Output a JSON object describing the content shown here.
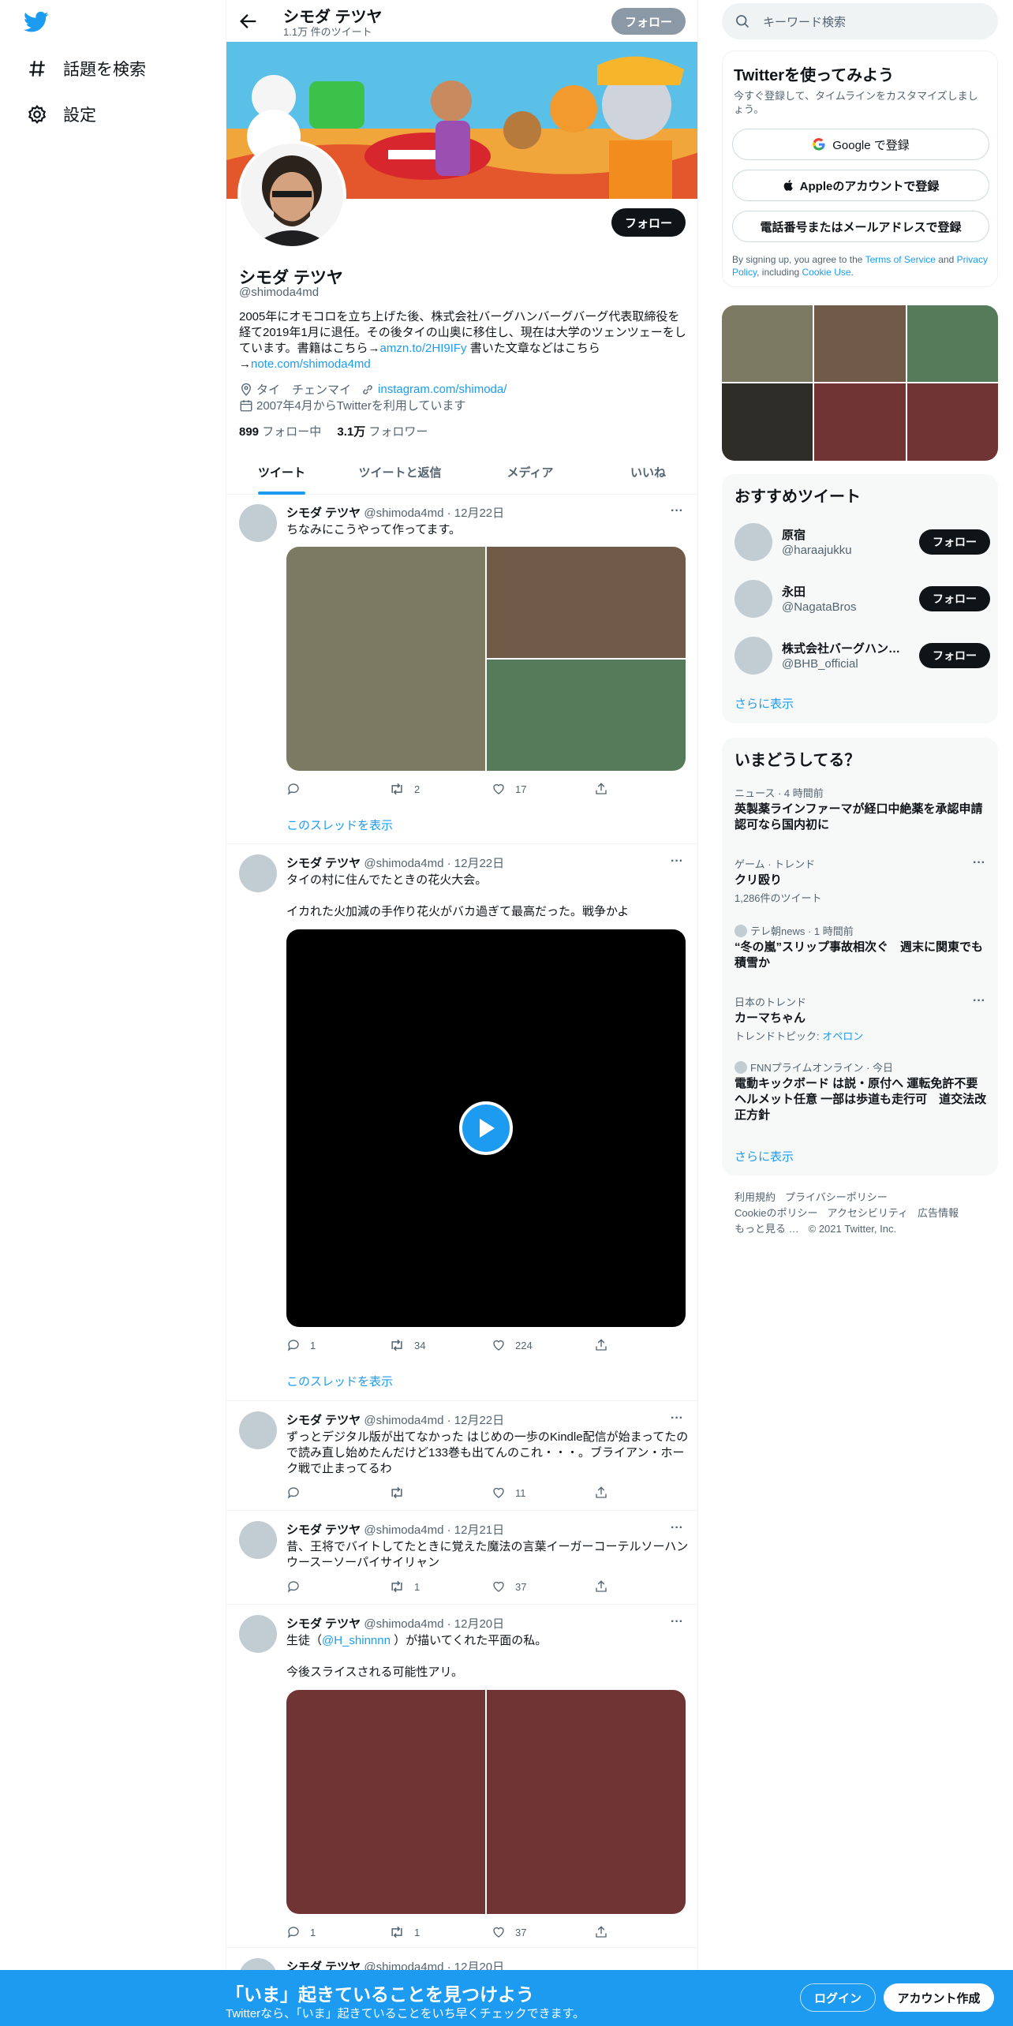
{
  "nav": {
    "explore_label": "話題を検索",
    "settings_label": "設定"
  },
  "header": {
    "name": "シモダ テツヤ",
    "tweet_count": "1.1万 件のツイート",
    "follow_label": "フォロー"
  },
  "profile": {
    "name": "シモダ テツヤ",
    "handle": "@shimoda4md",
    "follow_label": "フォロー",
    "bio_text_1": "2005年にオモコロを立ち上げた後、株式会社バーグハンバーグバーグ代表取締役を経て2019年1月に退任。その後タイの山奥に移住し、現在は大学のツェンツェーをしています。書籍はこちら→",
    "bio_link_1": "amzn.to/2HI9IFy",
    "bio_text_2": " 書いた文章などはこちら→",
    "bio_link_2": "note.com/shimoda4md",
    "location": "タイ　チェンマイ",
    "website": "instagram.com/shimoda/",
    "joined": "2007年4月からTwitterを利用しています",
    "following_count": "899",
    "following_label": " フォロー中",
    "followers_count": "3.1万",
    "followers_label": " フォロワー"
  },
  "tabs": [
    "ツイート",
    "ツイートと返信",
    "メディア",
    "いいね"
  ],
  "tweets": [
    {
      "name": "シモダ テツヤ",
      "meta": " @shimoda4md · 12月22日",
      "text": "ちなみにこうやって作ってます。",
      "reply": "",
      "retweet": "2",
      "like": "17",
      "thread": "このスレッドを表示"
    },
    {
      "name": "シモダ テツヤ",
      "meta": " @shimoda4md · 12月22日",
      "text": "タイの村に住んでたときの花火大会。\n\nイカれた火加減の手作り花火がバカ過ぎて最高だった。戦争かよ",
      "reply": "1",
      "retweet": "34",
      "like": "224",
      "thread": "このスレッドを表示"
    },
    {
      "name": "シモダ テツヤ",
      "meta": " @shimoda4md · 12月22日",
      "text": "ずっとデジタル版が出てなかった はじめの一歩のKindle配信が始まってたので読み直し始めたんだけど133巻も出てんのこれ・・・。ブライアン・ホーク戦で止まってるわ",
      "reply": "",
      "retweet": "",
      "like": "11"
    },
    {
      "name": "シモダ テツヤ",
      "meta": " @shimoda4md · 12月21日",
      "text": "昔、王将でバイトしてたときに覚えた魔法の言葉イーガーコーテルソーハンウースーソーパイサイリャン",
      "reply": "",
      "retweet": "1",
      "like": "37"
    },
    {
      "name": "シモダ テツヤ",
      "meta": " @shimoda4md · 12月20日",
      "text_a": "生徒（",
      "mention": "@H_shinnnn",
      "text_b": " ）が描いてくれた平面の私。",
      "text_c": "今後スライスされる可能性アリ。",
      "reply": "1",
      "retweet": "1",
      "like": "37"
    },
    {
      "name": "シモダ テツヤ",
      "meta": " @shimoda4md · 12月20日"
    }
  ],
  "right": {
    "search_placeholder": "キーワード検索",
    "signup": {
      "title": "Twitterを使ってみよう",
      "desc": "今すぐ登録して、タイムラインをカスタマイズしましょう。",
      "google": "Google で登録",
      "apple": "Appleのアカウントで登録",
      "phone": "電話番号またはメールアドレスで登録",
      "legal_a": "By signing up, you agree to the ",
      "tos": "Terms of Service",
      "legal_b": " and ",
      "privacy": "Privacy Policy",
      "legal_c": ", including ",
      "cookie": "Cookie Use",
      "legal_d": "."
    },
    "recommend": {
      "title": "おすすめツイート",
      "users": [
        {
          "name": "原宿",
          "handle": "@haraajukku",
          "btn": "フォロー"
        },
        {
          "name": "永田",
          "handle": "@NagataBros",
          "btn": "フォロー"
        },
        {
          "name": "株式会社バーグハン…",
          "handle": "@BHB_official",
          "btn": "フォロー"
        }
      ],
      "more": "さらに表示"
    },
    "trends": {
      "title": "いまどうしてる？",
      "items": [
        {
          "ctx": "ニュース · 4 時間前",
          "title": "英製薬ラインファーマが経口中絶薬を承認申請 認可なら国内初に",
          "sub": ""
        },
        {
          "ctx": "ゲーム · トレンド",
          "title": "クリ殴り",
          "sub": "1,286件のツイート"
        },
        {
          "ctx": "テレ朝news · 1 時間前",
          "title": "“冬の嵐”スリップ事故相次ぐ　週末に関東でも積雪か",
          "sub": ""
        },
        {
          "ctx": "日本のトレンド",
          "title": "カーマちゃん",
          "sub": "トレンドトピック: ",
          "sub_link": "オペロン"
        },
        {
          "ctx": "FNNプライムオンライン · 今日",
          "title": "電動キックボード は説・原付へ 運転免許不要 ヘルメット任意 一部は歩道も走行可　道交法改正方針",
          "sub": ""
        }
      ],
      "more": "さらに表示"
    },
    "footer": {
      "l1": [
        "利用規約",
        "プライバシーポリシー"
      ],
      "l2": [
        "Cookieのポリシー",
        "アクセシビリティ",
        "広告情報"
      ],
      "l3": [
        "もっと見る …",
        "© 2021 Twitter, Inc."
      ]
    }
  },
  "bottom": {
    "title": "「いま」起きていることを見つけよう",
    "sub": "Twitterなら、「いま」起きていることをいち早くチェックできます。",
    "login": "ログイン",
    "signup": "アカウント作成"
  },
  "colors": {
    "accent": "#1d9bf0",
    "media_1": "#7d7a63",
    "media_2": "#705b48",
    "media_3": "#567b5a",
    "media_4": "#2f2d27",
    "media_5": "#703434",
    "video_bg": "#000000"
  }
}
